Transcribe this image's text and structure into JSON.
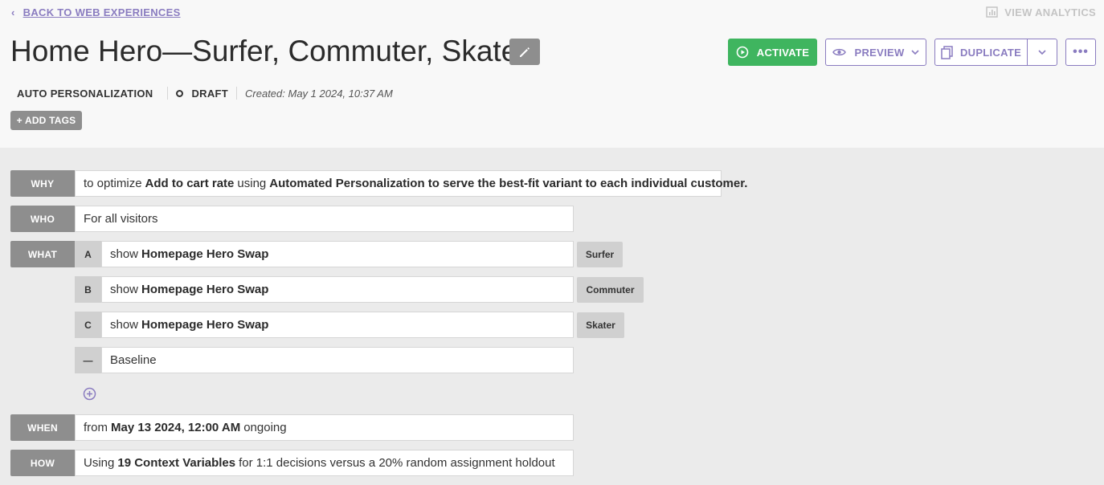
{
  "header": {
    "back_label": "BACK TO WEB EXPERIENCES",
    "view_analytics_label": "VIEW ANALYTICS",
    "title": "Home Hero—Surfer, Commuter, Skater",
    "type": "AUTO PERSONALIZATION",
    "status": "DRAFT",
    "created": "Created: May 1 2024, 10:37 AM",
    "add_tags_label": "+ ADD TAGS"
  },
  "toolbar": {
    "activate_label": "ACTIVATE",
    "preview_label": "PREVIEW",
    "duplicate_label": "DUPLICATE",
    "more_label": "•••"
  },
  "rows": {
    "why": {
      "label": "WHY",
      "prefix": "to optimize",
      "metric": "Add to cart rate",
      "mid": "using",
      "method": "Automated Personalization to serve the best-fit variant to each individual customer."
    },
    "who": {
      "label": "WHO",
      "text": "For all visitors"
    },
    "what": {
      "label": "WHAT",
      "variants": [
        {
          "letter": "A",
          "prefix": "show",
          "action": "Homepage Hero Swap",
          "tag": "Surfer"
        },
        {
          "letter": "B",
          "prefix": "show",
          "action": "Homepage Hero Swap",
          "tag": "Commuter"
        },
        {
          "letter": "C",
          "prefix": "show",
          "action": "Homepage Hero Swap",
          "tag": "Skater"
        },
        {
          "letter": "—",
          "text": "Baseline"
        }
      ]
    },
    "when": {
      "label": "WHEN",
      "prefix": "from",
      "date": "May 13 2024, 12:00 AM",
      "suffix": "ongoing"
    },
    "how": {
      "label": "HOW",
      "prefix": "Using",
      "vars": "19 Context Variables",
      "suffix": "for 1:1 decisions versus a 20% random assignment holdout"
    }
  },
  "colors": {
    "accent": "#8a7cc0",
    "activate": "#3fb55f",
    "label_bg": "#8e8e8e",
    "tag_bg": "#d0d0d0"
  }
}
